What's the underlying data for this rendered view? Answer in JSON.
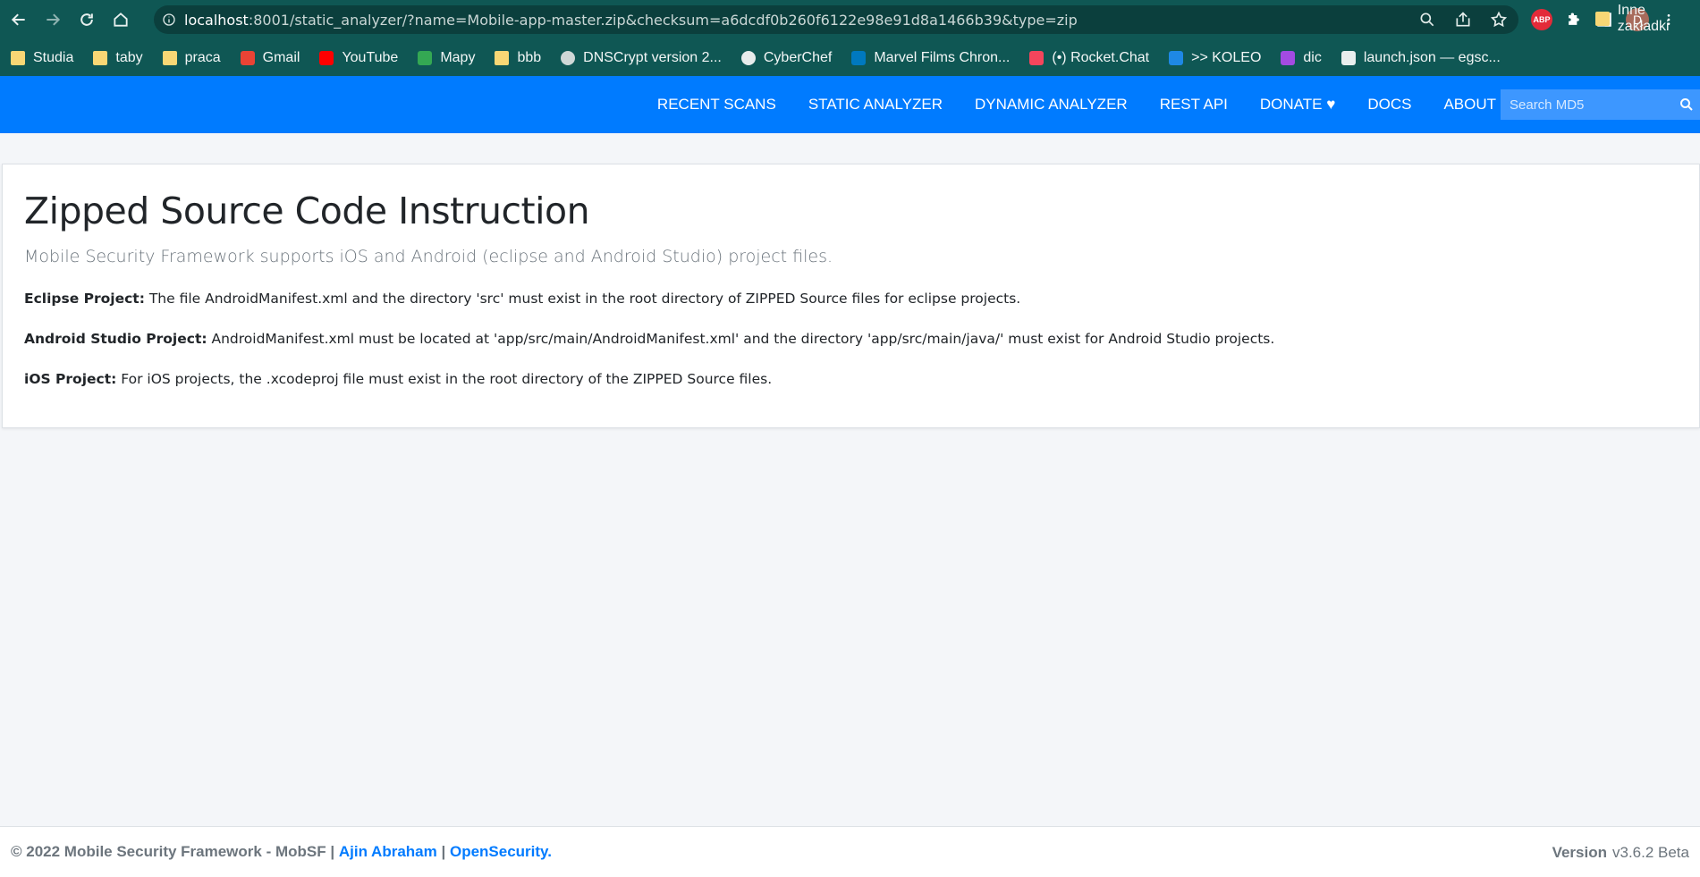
{
  "browser": {
    "url_host": "localhost",
    "url_rest": ":8001/static_analyzer/?name=Mobile-app-master.zip&checksum=a6dcdf0b260f6122e98e91d8a1466b39&type=zip",
    "profile_initial": "D",
    "abp_label": "ABP",
    "bookmarks": [
      {
        "label": "Studia",
        "icon": "folder"
      },
      {
        "label": "taby",
        "icon": "folder"
      },
      {
        "label": "praca",
        "icon": "folder"
      },
      {
        "label": "Gmail",
        "icon": "gmail-icon"
      },
      {
        "label": "YouTube",
        "icon": "youtube-icon"
      },
      {
        "label": "Mapy",
        "icon": "maps-icon"
      },
      {
        "label": "bbb",
        "icon": "folder"
      },
      {
        "label": "DNSCrypt version 2...",
        "icon": "globe-icon"
      },
      {
        "label": "CyberChef",
        "icon": "chef-icon"
      },
      {
        "label": "Marvel Films Chron...",
        "icon": "trello-icon"
      },
      {
        "label": "(•) Rocket.Chat",
        "icon": "rocket-icon"
      },
      {
        "label": ">> KOLEO",
        "icon": "koleo-icon"
      },
      {
        "label": "dic",
        "icon": "kotlin-icon"
      },
      {
        "label": "launch.json — egsc...",
        "icon": "vscode-icon"
      }
    ],
    "other_bookmarks": "Inne zakładki"
  },
  "navbar": {
    "links": [
      "RECENT SCANS",
      "STATIC ANALYZER",
      "DYNAMIC ANALYZER",
      "REST API",
      "DONATE ♥",
      "DOCS",
      "ABOUT"
    ],
    "search_placeholder": "Search MD5"
  },
  "content": {
    "title": "Zipped Source Code Instruction",
    "lead": "Mobile Security Framework supports iOS and Android (eclipse and Android Studio) project files.",
    "items": [
      {
        "label": "Eclipse Project:",
        "text": " The file AndroidManifest.xml and the directory 'src' must exist in the root directory of ZIPPED Source files for eclipse projects."
      },
      {
        "label": "Android Studio Project:",
        "text": " AndroidManifest.xml must be located at 'app/src/main/AndroidManifest.xml' and the directory 'app/src/main/java/' must exist for Android Studio projects."
      },
      {
        "label": "iOS Project:",
        "text": " For iOS projects, the .xcodeproj file must exist in the root directory of the ZIPPED Source files."
      }
    ]
  },
  "footer": {
    "copyright": "© 2022 Mobile Security Framework - MobSF |",
    "author": "Ajin Abraham",
    "sep": "|",
    "org": "OpenSecurity.",
    "version_label": "Version",
    "version_value": "v3.6.2 Beta"
  },
  "colors": {
    "chrome": "#0f5754",
    "navbar": "#007bff",
    "link": "#007bff"
  }
}
